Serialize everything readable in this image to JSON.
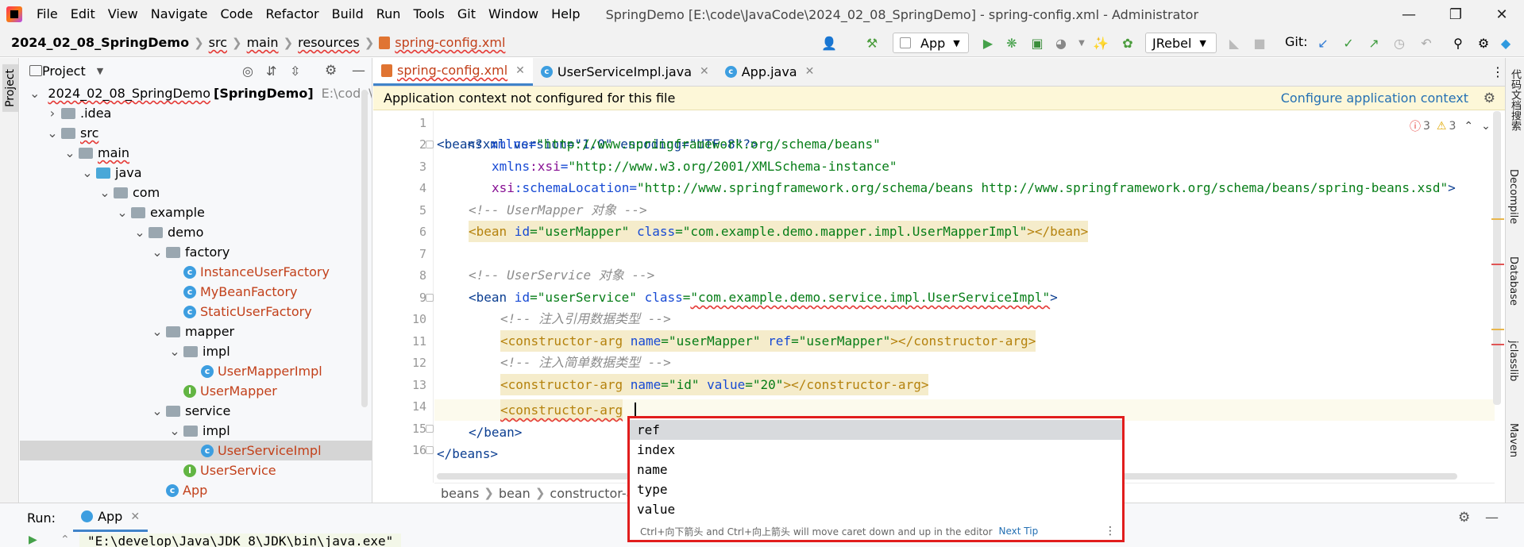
{
  "menu": {
    "items": [
      "File",
      "Edit",
      "View",
      "Navigate",
      "Code",
      "Refactor",
      "Build",
      "Run",
      "Tools",
      "Git",
      "Window",
      "Help"
    ],
    "window_title": "SpringDemo [E:\\code\\JavaCode\\2024_02_08_SpringDemo] - spring-config.xml - Administrator"
  },
  "nav": {
    "crumbs": [
      "2024_02_08_SpringDemo",
      "src",
      "main",
      "resources",
      "spring-config.xml"
    ],
    "run_config": "App",
    "jrebel": "JRebel",
    "git_label": "Git:"
  },
  "left_strip": {
    "project_label": "Project"
  },
  "project": {
    "title": "Project",
    "tree": [
      {
        "label": "2024_02_08_SpringDemo",
        "extra": "[SpringDemo]",
        "path": "E:\\code\\Java",
        "icon": "module-folder-icon",
        "arrow": "down",
        "indent": 0
      },
      {
        "label": ".idea",
        "icon": "folder-icon",
        "arrow": "right",
        "indent": 1
      },
      {
        "label": "src",
        "icon": "folder-icon",
        "arrow": "down",
        "indent": 1
      },
      {
        "label": "main",
        "icon": "folder-icon",
        "arrow": "down",
        "indent": 2
      },
      {
        "label": "java",
        "icon": "source-folder-icon",
        "arrow": "down",
        "indent": 3
      },
      {
        "label": "com",
        "icon": "package-icon",
        "arrow": "down",
        "indent": 4
      },
      {
        "label": "example",
        "icon": "package-icon",
        "arrow": "down",
        "indent": 5
      },
      {
        "label": "demo",
        "icon": "package-icon",
        "arrow": "down",
        "indent": 6
      },
      {
        "label": "factory",
        "icon": "package-icon",
        "arrow": "down",
        "indent": 7
      },
      {
        "label": "InstanceUserFactory",
        "icon": "class-icon",
        "indent": 8
      },
      {
        "label": "MyBeanFactory",
        "icon": "class-icon",
        "indent": 8
      },
      {
        "label": "StaticUserFactory",
        "icon": "class-icon",
        "indent": 8
      },
      {
        "label": "mapper",
        "icon": "package-icon",
        "arrow": "down",
        "indent": 7
      },
      {
        "label": "impl",
        "icon": "package-icon",
        "arrow": "down",
        "indent": 8
      },
      {
        "label": "UserMapperImpl",
        "icon": "class-icon",
        "indent": 9
      },
      {
        "label": "UserMapper",
        "icon": "interface-icon",
        "indent": 8
      },
      {
        "label": "service",
        "icon": "package-icon",
        "arrow": "down",
        "indent": 7
      },
      {
        "label": "impl",
        "icon": "package-icon",
        "arrow": "down",
        "indent": 8
      },
      {
        "label": "UserServiceImpl",
        "icon": "class-icon",
        "indent": 9,
        "selected": true
      },
      {
        "label": "UserService",
        "icon": "interface-icon",
        "indent": 8
      },
      {
        "label": "App",
        "icon": "app-class-icon",
        "indent": 7
      }
    ]
  },
  "editor": {
    "tabs": [
      {
        "label": "spring-config.xml",
        "icon": "xml-file-icon",
        "active": true
      },
      {
        "label": "UserServiceImpl.java",
        "icon": "java-class-icon"
      },
      {
        "label": "App.java",
        "icon": "java-class-icon"
      }
    ],
    "banner_text": "Application context not configured for this file",
    "banner_link": "Configure application context",
    "inspections": {
      "errors": "3",
      "warnings": "3"
    },
    "line_numbers": [
      "1",
      "2",
      "3",
      "4",
      "5",
      "6",
      "7",
      "8",
      "9",
      "10",
      "11",
      "12",
      "13",
      "14",
      "15",
      "16"
    ],
    "code": {
      "l1": "<?xml version=\"1.0\" encoding=\"UTF-8\"?>",
      "l2_tag": "<beans",
      "l2_attr": " xmlns",
      "l2_eq": "=",
      "l2_val": "\"http://www.springframework.org/schema/beans\"",
      "l3_ns": "xmlns",
      "l3_attr": ":xsi",
      "l3_eq": "=",
      "l3_val": "\"http://www.w3.org/2001/XMLSchema-instance\"",
      "l4_ns": "xsi",
      "l4_attr": ":schemaLocation",
      "l4_eq": "=",
      "l4_val": "\"http://www.springframework.org/schema/beans http://www.springframework.org/schema/beans/spring-beans.xsd\"",
      "l4_end": ">",
      "l5": "<!-- UserMapper 对象 -->",
      "l6_tag": "<bean",
      "l6_a1": " id",
      "l6_v1": "=\"userMapper\"",
      "l6_a2": " class",
      "l6_v2": "=\"com.example.demo.mapper.impl.UserMapperImpl\"",
      "l6_end": "></bean>",
      "l8": "<!-- UserService 对象 -->",
      "l9_tag": "<bean",
      "l9_a1": " id",
      "l9_v1": "=\"userService\"",
      "l9_a2": " class",
      "l9_eq": "=",
      "l9_v2": "\"com.example.demo.service.impl.UserServiceImpl\"",
      "l9_end": ">",
      "l10": "<!-- 注入引用数据类型 -->",
      "l11_tag": "<constructor-arg",
      "l11_a1": " name",
      "l11_v1": "=\"userMapper\"",
      "l11_a2": " ref",
      "l11_v2": "=\"userMapper\"",
      "l11_end": "></constructor-arg>",
      "l12": "<!-- 注入简单数据类型 -->",
      "l13_tag": "<constructor-arg",
      "l13_a1": " name",
      "l13_v1": "=\"id\"",
      "l13_a2": " value",
      "l13_v2": "=\"20\"",
      "l13_end": "></constructor-arg>",
      "l14_tag": "<constructor-arg",
      "l15": "</bean>",
      "l16": "</beans>"
    },
    "breadcrumb": [
      "beans",
      "bean",
      "constructor-a"
    ]
  },
  "completion": {
    "items": [
      "ref",
      "index",
      "name",
      "type",
      "value"
    ],
    "footer": "Ctrl+向下箭头 and Ctrl+向上箭头 will move caret down and up in the editor",
    "tip_link": "Next Tip"
  },
  "right_strip": {
    "labels": [
      "代码文档搜索",
      "Decompile",
      "Database",
      "jclasslib",
      "Maven"
    ]
  },
  "run_panel": {
    "label": "Run:",
    "tab": "App",
    "output": "\"E:\\develop\\Java\\JDK 8\\JDK\\bin\\java.exe\""
  },
  "colors": {
    "accent": "#4083c9",
    "completion_border": "#e11d1d",
    "banner_bg": "#fdf7d8"
  }
}
